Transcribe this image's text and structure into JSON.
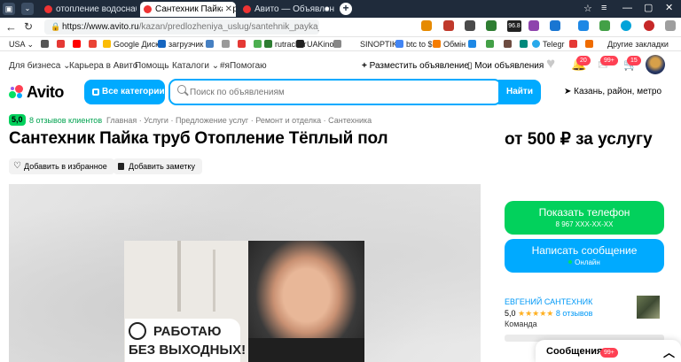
{
  "browser": {
    "tabs": [
      {
        "title": "отопление водоснабжение",
        "active": false
      },
      {
        "title": "Сантехник Пайка труб",
        "active": true
      },
      {
        "title": "Авито — Объявления н",
        "active": false
      }
    ],
    "new_tab_label": "+",
    "url_host": "https://www.avito.ru",
    "url_path": "/kazan/predlozheniya_uslug/santehnik_payka_t...",
    "bookmarks": [
      "USA",
      "Google Диск",
      "загрузчик",
      "rutracker",
      "UAKino",
      "SINOPTIK",
      "btc to $",
      "Обмін",
      "Telegr",
      "Другие закладки"
    ],
    "ext_badge": "96.8"
  },
  "header": {
    "links": [
      "Для бизнеса",
      "Карьера в Авито",
      "Помощь",
      "Каталоги",
      "#яПомогаю"
    ],
    "post_ad": "Разместить объявление",
    "my_ads": "Мои объявления",
    "badges": {
      "notifications": "20",
      "messages": "99+",
      "cart": "15"
    }
  },
  "logo": "Avito",
  "all_categories": "Все категории",
  "search": {
    "placeholder": "Поиск по объявлениям",
    "button": "Найти"
  },
  "location": {
    "city": "Казань,",
    "rest": "район, метро"
  },
  "listing": {
    "rating": "5,0",
    "reviews_link": "8 отзывов клиентов",
    "breadcrumbs": [
      "Главная",
      "Услуги",
      "Предложение услуг",
      "Ремонт и отделка",
      "Сантехника"
    ],
    "title": "Сантехник Пайка труб Отопление Тёплый пол",
    "price": "от 500 ₽ за услугу",
    "favorite_label": "Добавить в избранное",
    "note_label": "Добавить заметку",
    "photo_caption_1": "РАБОТАЮ",
    "photo_caption_2": "БЕЗ ВЫХОДНЫХ!"
  },
  "contact": {
    "show_phone": "Показать телефон",
    "phone_masked": "8 967 XXX-XX-XX",
    "write_message": "Написать сообщение",
    "online": "Онлайн"
  },
  "seller": {
    "name": "ЕВГЕНИЙ САНТЕХНИК",
    "rating": "5,0",
    "stars": 5,
    "stars_text": "★★★★★",
    "reviews": "8 отзывов",
    "type": "Команда"
  },
  "messages_widget": {
    "label": "Сообщения",
    "badge": "99+"
  },
  "colors": {
    "accent": "#00aaff",
    "green": "#02d15c",
    "badge_red": "#ff4053",
    "link": "#0099f7"
  }
}
